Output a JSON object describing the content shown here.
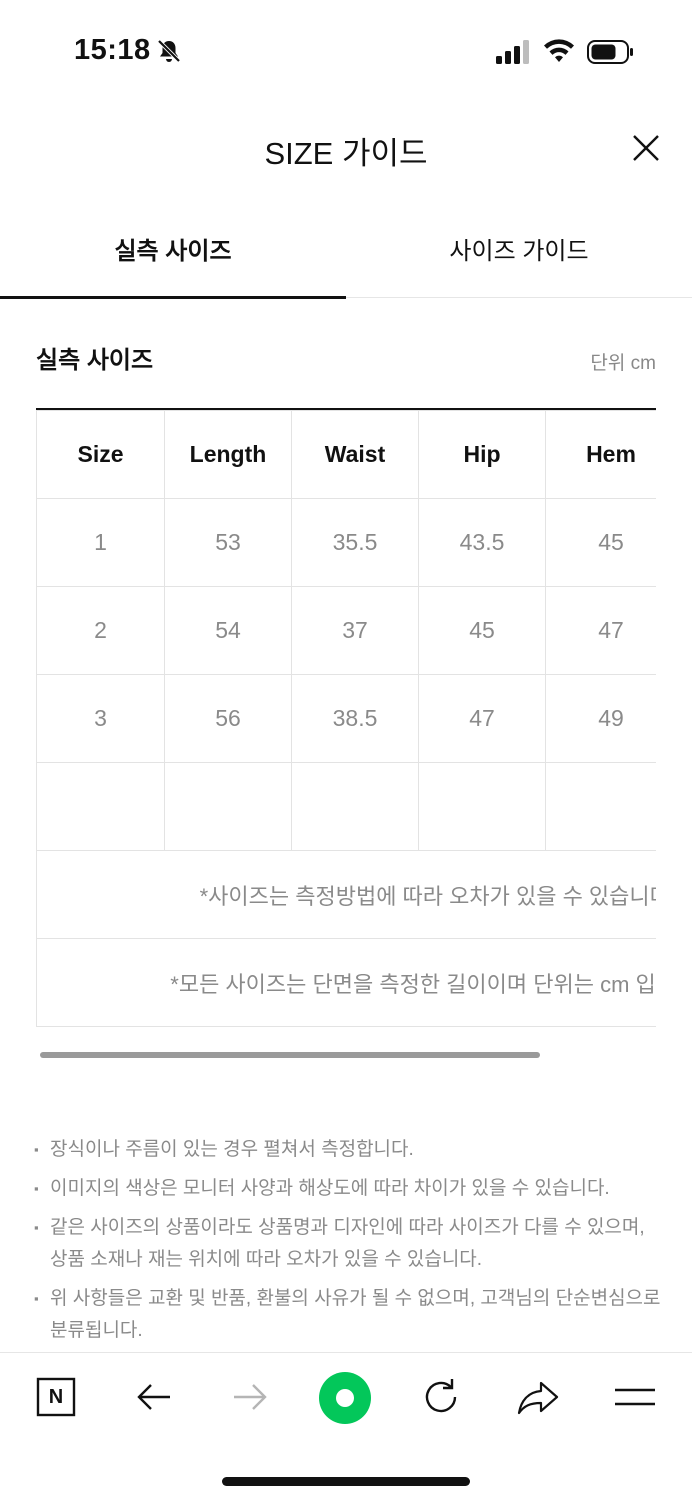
{
  "status_bar": {
    "time": "15:18"
  },
  "header": {
    "title": "SIZE 가이드"
  },
  "tabs": [
    {
      "label": "실측 사이즈",
      "active": true
    },
    {
      "label": "사이즈 가이드",
      "active": false
    }
  ],
  "section": {
    "title": "실측 사이즈",
    "unit": "단위 cm"
  },
  "table": {
    "headers": [
      "Size",
      "Length",
      "Waist",
      "Hip",
      "Hem"
    ],
    "rows": [
      [
        "1",
        "53",
        "35.5",
        "43.5",
        "45"
      ],
      [
        "2",
        "54",
        "37",
        "45",
        "47"
      ],
      [
        "3",
        "56",
        "38.5",
        "47",
        "49"
      ],
      [
        "",
        "",
        "",
        "",
        ""
      ]
    ],
    "notes": [
      "*사이즈는 측정방법에 따라 오차가 있을 수 있습니다.",
      "*모든 사이즈는 단면을 측정한 길이이며 단위는 cm 입니"
    ]
  },
  "bullets": [
    {
      "lines": [
        "장식이나 주름이 있는 경우 펼쳐서 측정합니다."
      ]
    },
    {
      "lines": [
        "이미지의 색상은 모니터 사양과 해상도에 따라 차이가 있을 수 있습니다."
      ]
    },
    {
      "lines": [
        "같은 사이즈의 상품이라도 상품명과 디자인에 따라 사이즈가 다를 수 있으며,",
        "상품 소재나 재는 위치에 따라 오차가 있을 수 있습니다."
      ]
    },
    {
      "lines": [
        "위 사항들은 교환 및 반품, 환불의 사유가 될 수 없으며, 고객님의 단순변심으로",
        "분류됩니다."
      ]
    }
  ],
  "toolbar": {
    "naver_label": "N",
    "accent_color": "#03c75a"
  }
}
